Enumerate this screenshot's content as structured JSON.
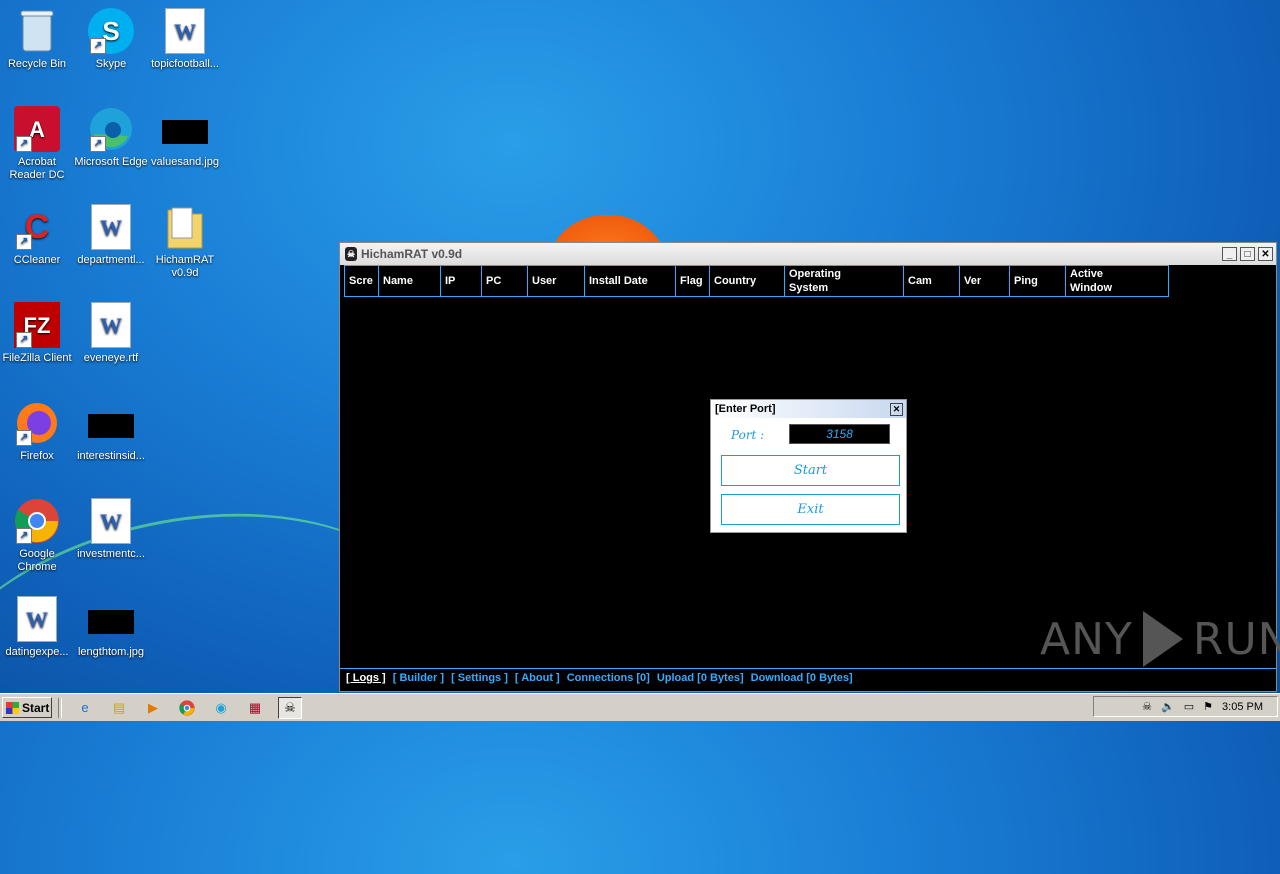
{
  "desktop": {
    "icons": [
      {
        "label": "Recycle Bin",
        "icon": "recycle-bin-icon"
      },
      {
        "label": "Skype",
        "icon": "skype-icon"
      },
      {
        "label": "topicfootball...",
        "icon": "word-doc-icon"
      },
      {
        "label": "Acrobat Reader DC",
        "icon": "acrobat-icon"
      },
      {
        "label": "Microsoft Edge",
        "icon": "edge-icon"
      },
      {
        "label": "valuesand.jpg",
        "icon": "image-file-icon"
      },
      {
        "label": "CCleaner",
        "icon": "ccleaner-icon"
      },
      {
        "label": "departmentl...",
        "icon": "word-doc-icon"
      },
      {
        "label": "HichamRAT v0.9d",
        "icon": "folder-icon"
      },
      {
        "label": "FileZilla Client",
        "icon": "filezilla-icon"
      },
      {
        "label": "eveneye.rtf",
        "icon": "word-doc-icon"
      },
      {
        "label": "Firefox",
        "icon": "firefox-icon"
      },
      {
        "label": "interestinsid...",
        "icon": "image-file-icon"
      },
      {
        "label": "Google Chrome",
        "icon": "chrome-icon"
      },
      {
        "label": "investmentc...",
        "icon": "word-doc-icon"
      },
      {
        "label": "datingexpe...",
        "icon": "word-doc-icon"
      },
      {
        "label": "lengthtom.jpg",
        "icon": "image-file-icon"
      }
    ]
  },
  "window": {
    "title": "HichamRAT v0.9d",
    "columns": [
      "Scre",
      "Name",
      "IP",
      "PC",
      "User",
      "Install Date",
      "Flag",
      "Country",
      "Operating\nSystem",
      "Cam",
      "Ver",
      "Ping",
      "Active\nWindow"
    ],
    "status": {
      "logs": "[ Logs ]",
      "builder": "[ Builder ]",
      "settings": "[ Settings ]",
      "about": "[ About ]",
      "connections": "Connections [0]",
      "upload": "Upload [0 Bytes]",
      "download": "Download [0 Bytes]"
    }
  },
  "dialog": {
    "title": "[Enter Port]",
    "port_label": "Port :",
    "port_value": "3158",
    "start_label": "Start",
    "exit_label": "Exit"
  },
  "watermark": {
    "left": "ANY",
    "right": "RUN"
  },
  "taskbar": {
    "start_label": "Start",
    "clock": "3:05 PM"
  },
  "colors": {
    "accent": "#33aaff",
    "desktop": "#1a7fd6"
  }
}
